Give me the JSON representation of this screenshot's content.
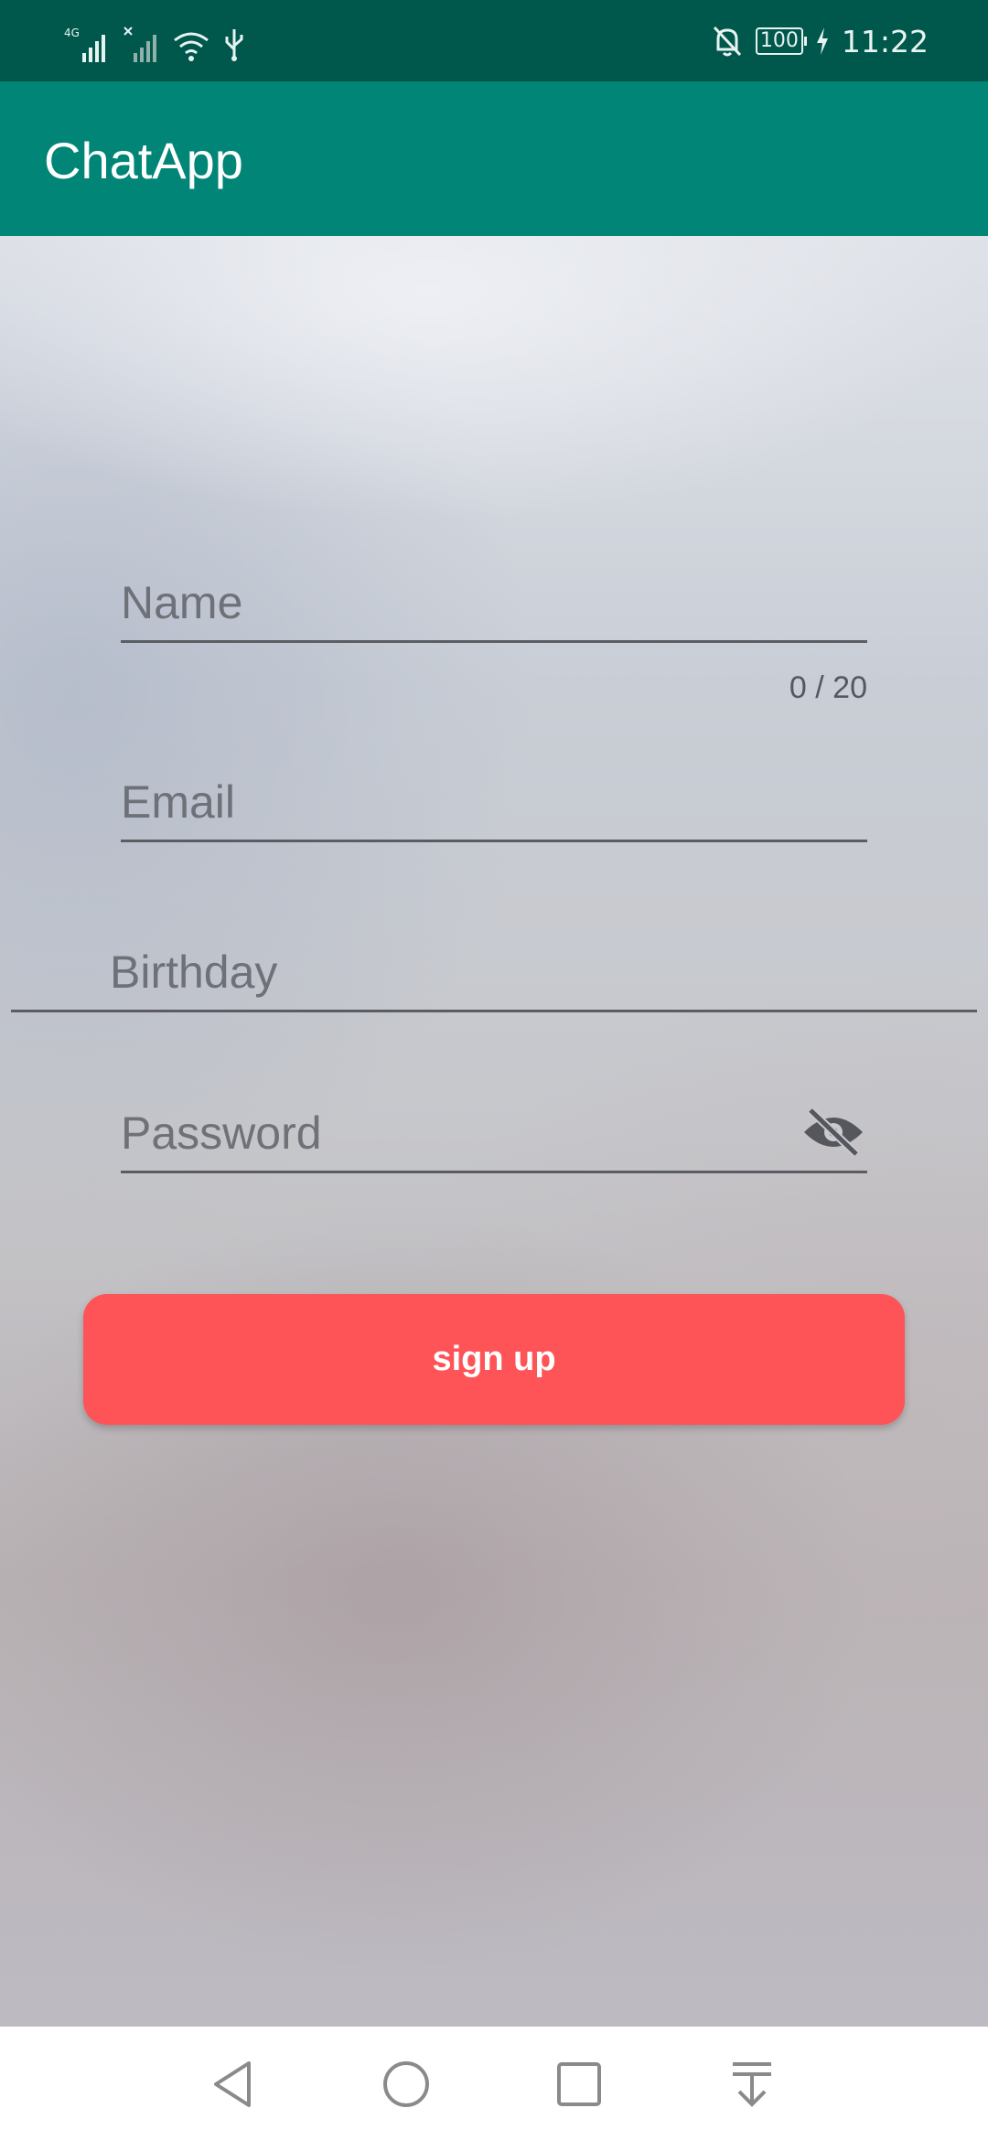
{
  "status_bar": {
    "network_label": "4G",
    "battery": "100",
    "time": "11:22",
    "icons": [
      "signal-icon",
      "signal-off-icon",
      "wifi-icon",
      "usb-icon",
      "bell-off-icon",
      "battery-icon",
      "charging-icon"
    ]
  },
  "app_bar": {
    "title": "ChatApp"
  },
  "form": {
    "name_placeholder": "Name",
    "name_counter": "0 / 20",
    "email_placeholder": "Email",
    "birthday_placeholder": "Birthday",
    "password_placeholder": "Password",
    "signup_label": "sign up"
  },
  "nav_bar": {
    "icons": [
      "back-icon",
      "home-icon",
      "recents-icon",
      "notification-shade-icon"
    ]
  },
  "colors": {
    "status_bar": "#00574b",
    "app_bar": "#008577",
    "signup_button": "#fe5457",
    "field_line": "#5b5d62"
  }
}
